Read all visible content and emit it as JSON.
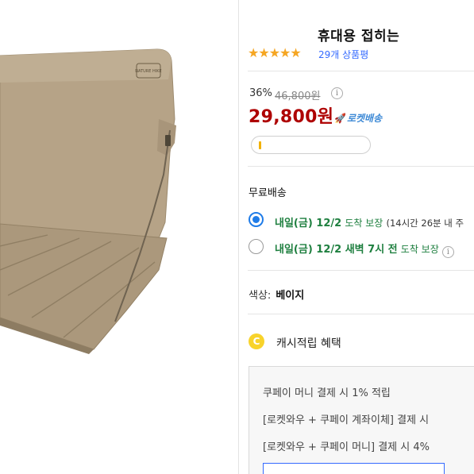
{
  "product": {
    "title": "휴대용 접히는",
    "stars": "★★★★★",
    "review_count": "29개 상품평",
    "image": {
      "brand_mark": "NATURE HIKE"
    }
  },
  "price": {
    "discount": "36%",
    "original": "46,800원",
    "info_icon": "i",
    "sale": "29,800원",
    "delivery_badge": "로켓배송"
  },
  "shipping": {
    "title": "무료배송",
    "options": [
      {
        "selected": true,
        "date": "내일(금) 12/2",
        "suffix": "도착 보장",
        "note": "(14시간 26분 내 주"
      },
      {
        "selected": false,
        "date": "내일(금) 12/2 새벽 7시 전",
        "suffix": "도착 보장",
        "info_icon": "i"
      }
    ]
  },
  "color": {
    "label": "색상:",
    "value": "베이지"
  },
  "cash": {
    "icon_letter": "C",
    "label": "캐시적립 혜택"
  },
  "benefits": {
    "lines": [
      "쿠페이 머니 결제 시 1% 적립",
      "[로켓와우 + 쿠페이 계좌이체] 결제 시",
      "[로켓와우 + 쿠페이 머니] 결제 시 4%"
    ]
  },
  "colors": {
    "price_red": "#ae0000",
    "star_gold": "#f5a623",
    "review_blue": "#346aff",
    "delivery_green": "#1e7f3f",
    "radio_blue": "#1f7ce8",
    "fabric_beige": "#b3a085"
  }
}
